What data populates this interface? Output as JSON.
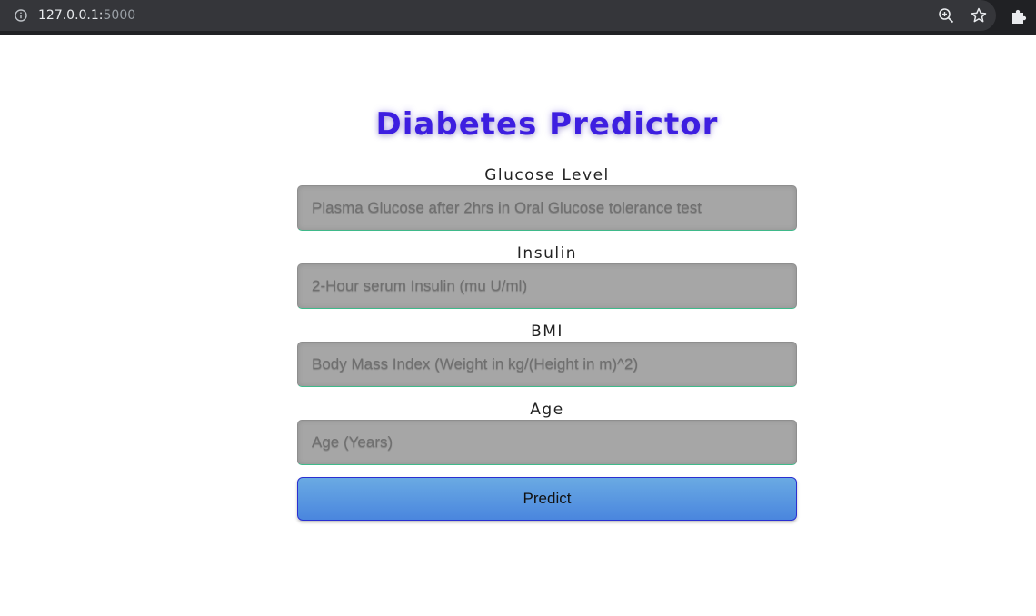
{
  "browser": {
    "url_host": "127.0.0.1:",
    "url_port": "5000",
    "icons": [
      "info-icon",
      "zoom-icon",
      "star-icon",
      "extensions-icon"
    ]
  },
  "page": {
    "title": "Diabetes Predictor",
    "fields": [
      {
        "label": "Glucose Level",
        "placeholder": "Plasma Glucose after 2hrs in Oral Glucose tolerance test"
      },
      {
        "label": "Insulin",
        "placeholder": "2-Hour serum Insulin (mu U/ml)"
      },
      {
        "label": "BMI",
        "placeholder": "Body Mass Index (Weight in kg/(Height in m)^2)"
      },
      {
        "label": "Age",
        "placeholder": "Age (Years)"
      }
    ],
    "submit_label": "Predict"
  },
  "colors": {
    "title": "#3d1ee0",
    "field_bg": "#a6a6a6",
    "button_top": "#6aaae3",
    "button_bottom": "#4a86de",
    "chrome_bg": "#202124"
  }
}
